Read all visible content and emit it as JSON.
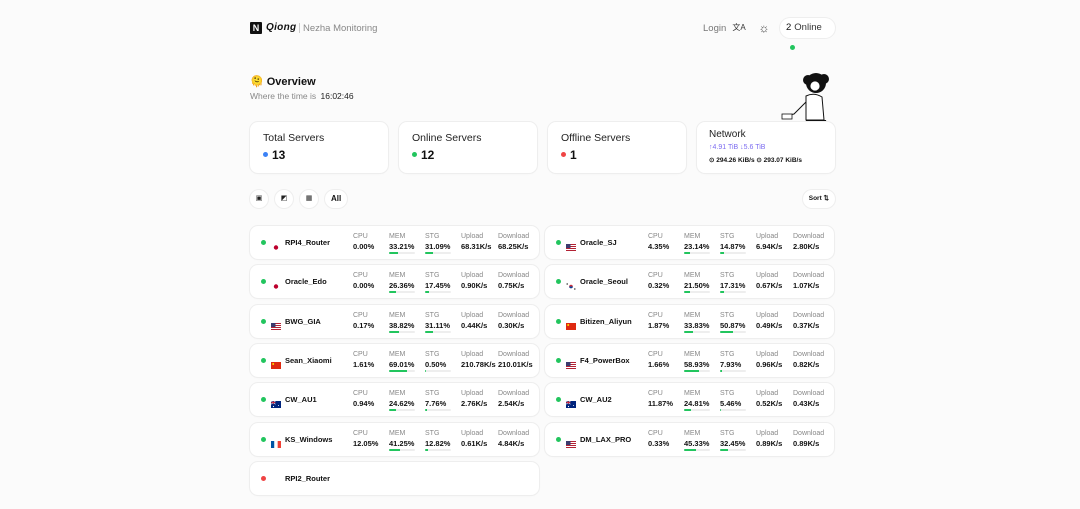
{
  "header": {
    "logo_letter": "N",
    "brand": "Qiong",
    "subtitle": "Nezha Monitoring",
    "login_label": "Login",
    "lang_icon": "文A",
    "theme_icon": "☼",
    "online_count": "2",
    "online_label": "Online"
  },
  "overview": {
    "emoji": "🫠",
    "title": "Overview",
    "time_prefix": "Where the time is",
    "time": "16:02:46"
  },
  "stats": {
    "total": {
      "label": "Total Servers",
      "value": "13",
      "color": "#3b82f6"
    },
    "online": {
      "label": "Online Servers",
      "value": "12",
      "color": "#22c55e"
    },
    "offline": {
      "label": "Offline Servers",
      "value": "1",
      "color": "#ef4444"
    },
    "network": {
      "label": "Network",
      "up_total": "↑4.91 TiB",
      "down_total": "↓5.6 TiB",
      "up_speed": "294.26 KiB/s",
      "down_speed": "293.07 KiB/s"
    }
  },
  "filters": {
    "btn1": "▣",
    "btn2": "◩",
    "btn3": "▦",
    "all": "All",
    "sort": "Sort ⇅"
  },
  "metric_labels": {
    "cpu": "CPU",
    "mem": "MEM",
    "stg": "STG",
    "up": "Upload",
    "down": "Download"
  },
  "colors": {
    "online": "#22c55e",
    "offline": "#ef4444",
    "bar": "#22c55e"
  },
  "servers": [
    {
      "name": "RPI4_Router",
      "flag": "jp",
      "online": true,
      "cpu": "0.00%",
      "mem": "33.21%",
      "stg": "31.09%",
      "up": "68.31K/s",
      "down": "68.25K/s",
      "cpu_pct": 0,
      "mem_pct": 33,
      "stg_pct": 31
    },
    {
      "name": "Oracle_SJ",
      "flag": "us",
      "online": true,
      "cpu": "4.35%",
      "mem": "23.14%",
      "stg": "14.87%",
      "up": "6.94K/s",
      "down": "2.80K/s",
      "cpu_pct": 4,
      "mem_pct": 23,
      "stg_pct": 15
    },
    {
      "name": "Oracle_Edo",
      "flag": "jp",
      "online": true,
      "cpu": "0.00%",
      "mem": "26.36%",
      "stg": "17.45%",
      "up": "0.90K/s",
      "down": "0.75K/s",
      "cpu_pct": 0,
      "mem_pct": 26,
      "stg_pct": 17
    },
    {
      "name": "Oracle_Seoul",
      "flag": "kr",
      "online": true,
      "cpu": "0.32%",
      "mem": "21.50%",
      "stg": "17.31%",
      "up": "0.67K/s",
      "down": "1.07K/s",
      "cpu_pct": 1,
      "mem_pct": 22,
      "stg_pct": 17
    },
    {
      "name": "BWG_GIA",
      "flag": "us",
      "online": true,
      "cpu": "0.17%",
      "mem": "38.82%",
      "stg": "31.11%",
      "up": "0.44K/s",
      "down": "0.30K/s",
      "cpu_pct": 1,
      "mem_pct": 39,
      "stg_pct": 31
    },
    {
      "name": "Bitizen_Aliyun",
      "flag": "cn",
      "online": true,
      "cpu": "1.87%",
      "mem": "33.83%",
      "stg": "50.87%",
      "up": "0.49K/s",
      "down": "0.37K/s",
      "cpu_pct": 2,
      "mem_pct": 34,
      "stg_pct": 51
    },
    {
      "name": "Sean_Xiaomi",
      "flag": "cn",
      "online": true,
      "cpu": "1.61%",
      "mem": "69.01%",
      "stg": "0.50%",
      "up": "210.78K/s",
      "down": "210.01K/s",
      "cpu_pct": 2,
      "mem_pct": 69,
      "stg_pct": 1
    },
    {
      "name": "F4_PowerBox",
      "flag": "us",
      "online": true,
      "cpu": "1.66%",
      "mem": "58.93%",
      "stg": "7.93%",
      "up": "0.96K/s",
      "down": "0.82K/s",
      "cpu_pct": 2,
      "mem_pct": 59,
      "stg_pct": 8
    },
    {
      "name": "CW_AU1",
      "flag": "au",
      "online": true,
      "cpu": "0.94%",
      "mem": "24.62%",
      "stg": "7.76%",
      "up": "2.76K/s",
      "down": "2.54K/s",
      "cpu_pct": 1,
      "mem_pct": 25,
      "stg_pct": 8
    },
    {
      "name": "CW_AU2",
      "flag": "au",
      "online": true,
      "cpu": "11.87%",
      "mem": "24.81%",
      "stg": "5.46%",
      "up": "0.52K/s",
      "down": "0.43K/s",
      "cpu_pct": 12,
      "mem_pct": 25,
      "stg_pct": 5
    },
    {
      "name": "KS_Windows",
      "flag": "fr",
      "online": true,
      "cpu": "12.05%",
      "mem": "41.25%",
      "stg": "12.82%",
      "up": "0.61K/s",
      "down": "4.84K/s",
      "cpu_pct": 12,
      "mem_pct": 41,
      "stg_pct": 13
    },
    {
      "name": "DM_LAX_PRO",
      "flag": "us",
      "online": true,
      "cpu": "0.33%",
      "mem": "45.33%",
      "stg": "32.45%",
      "up": "0.89K/s",
      "down": "0.89K/s",
      "cpu_pct": 1,
      "mem_pct": 45,
      "stg_pct": 32
    },
    {
      "name": "RPI2_Router",
      "flag": "",
      "online": false
    }
  ]
}
